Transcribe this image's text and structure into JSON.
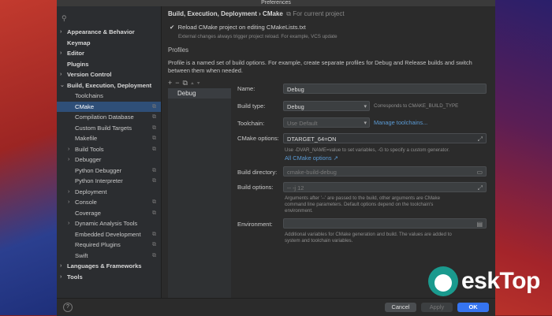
{
  "window": {
    "title": "Preferences"
  },
  "sidebar": {
    "items": [
      {
        "label": "Appearance & Behavior",
        "chev": ">"
      },
      {
        "label": "Keymap",
        "chev": ""
      },
      {
        "label": "Editor",
        "chev": ">"
      },
      {
        "label": "Plugins",
        "chev": ""
      },
      {
        "label": "Version Control",
        "chev": ">"
      },
      {
        "label": "Build, Execution, Deployment",
        "chev": "v"
      },
      {
        "label": "Toolchains",
        "chev": ""
      },
      {
        "label": "CMake",
        "chev": ""
      },
      {
        "label": "Compilation Database",
        "chev": ""
      },
      {
        "label": "Custom Build Targets",
        "chev": ""
      },
      {
        "label": "Makefile",
        "chev": ""
      },
      {
        "label": "Build Tools",
        "chev": ">"
      },
      {
        "label": "Debugger",
        "chev": ">"
      },
      {
        "label": "Python Debugger",
        "chev": ""
      },
      {
        "label": "Python Interpreter",
        "chev": ""
      },
      {
        "label": "Deployment",
        "chev": ">"
      },
      {
        "label": "Console",
        "chev": ">"
      },
      {
        "label": "Coverage",
        "chev": ""
      },
      {
        "label": "Dynamic Analysis Tools",
        "chev": ">"
      },
      {
        "label": "Embedded Development",
        "chev": ""
      },
      {
        "label": "Required Plugins",
        "chev": ""
      },
      {
        "label": "Swift",
        "chev": ""
      },
      {
        "label": "Languages & Frameworks",
        "chev": ">"
      },
      {
        "label": "Tools",
        "chev": ">"
      }
    ]
  },
  "main": {
    "breadcrumb_parent": "Build, Execution, Deployment",
    "breadcrumb_sep": "›",
    "breadcrumb_current": "CMake",
    "breadcrumb_scope": "For current project",
    "reload_label": "Reload CMake project on editing CMakeLists.txt",
    "reload_hint": "External changes always trigger project reload. For example, VCS update",
    "profiles_title": "Profiles",
    "profiles_desc": "Profile is a named set of build options. For example, create separate profiles for Debug and Release builds and switch between them when needed.",
    "profile_list": [
      "Debug"
    ],
    "form": {
      "name_label": "Name:",
      "name_value": "Debug",
      "build_type_label": "Build type:",
      "build_type_value": "Debug",
      "build_type_note": "Corresponds to CMAKE_BUILD_TYPE",
      "toolchain_label": "Toolchain:",
      "toolchain_value": "Use Default",
      "manage_toolchains": "Manage toolchains...",
      "cmake_options_label": "CMake options:",
      "cmake_options_value": "DTARGET_64=ON",
      "cmake_options_hint": "Use -DVAR_NAME=value to set variables, -G to specify a custom generator.",
      "all_cmake_options": "All CMake options ↗",
      "build_dir_label": "Build directory:",
      "build_dir_value": "cmake-build-debug",
      "build_options_label": "Build options:",
      "build_options_value": "-- -j 12",
      "build_options_hint": "Arguments after '--' are passed to the build, other arguments are CMake command line parameters. Default options depend on the toolchain's environment.",
      "env_label": "Environment:",
      "env_hint": "Additional variables for CMake generation and build. The values are added to system and toolchain variables."
    }
  },
  "footer": {
    "help": "?",
    "cancel": "Cancel",
    "apply": "Apply",
    "ok": "OK"
  },
  "watermark": {
    "text": "eskTop"
  }
}
